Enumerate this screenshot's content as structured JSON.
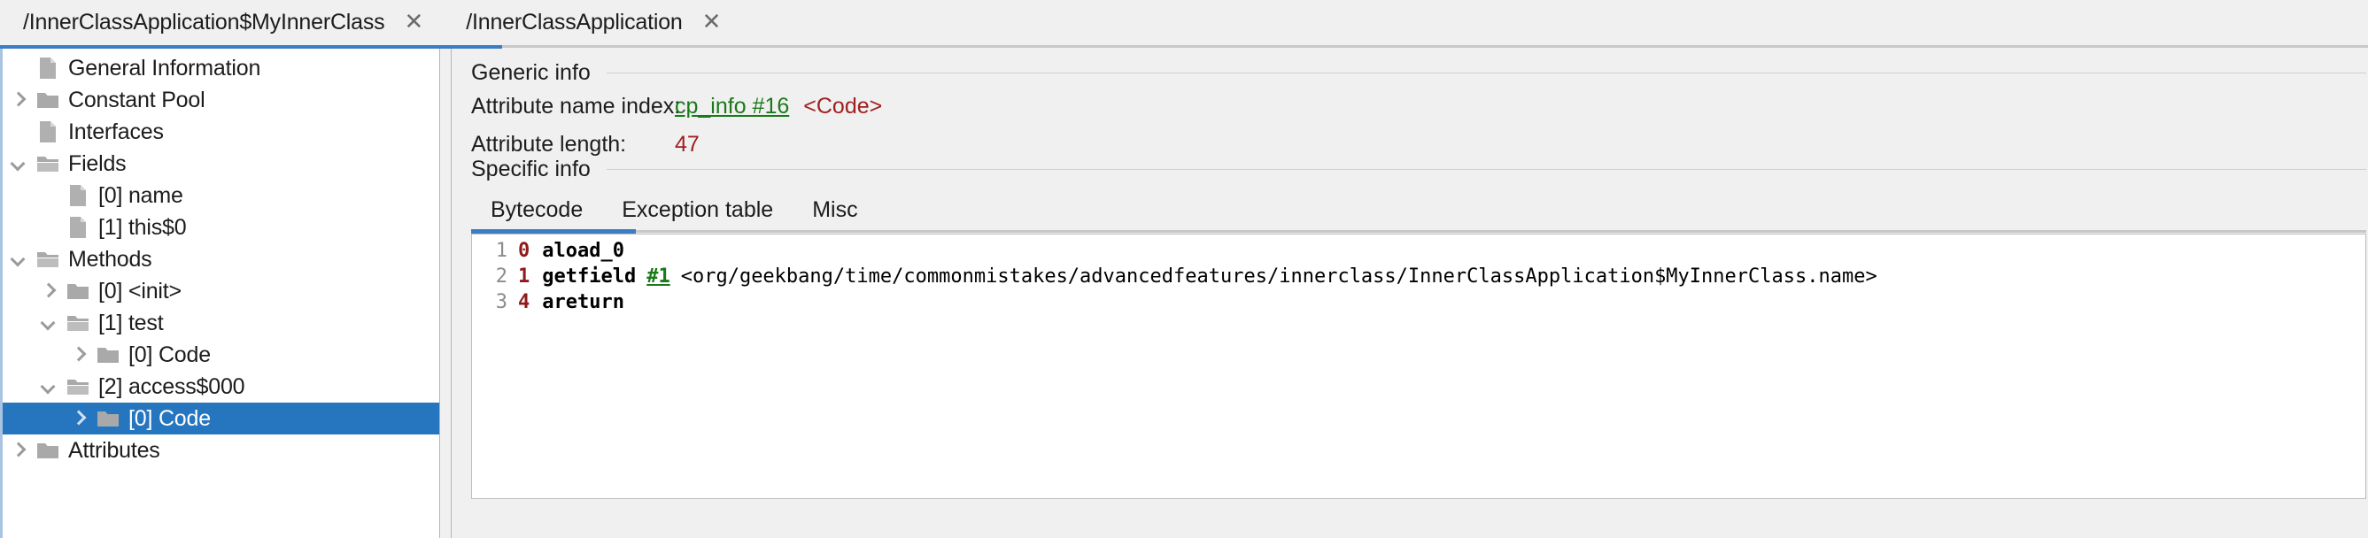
{
  "window": {
    "tabs": [
      {
        "label": "/InnerClassApplication$MyInnerClass",
        "close": "✕",
        "active": true
      },
      {
        "label": "/InnerClassApplication",
        "close": "✕",
        "active": false
      }
    ]
  },
  "tree": {
    "items": [
      {
        "label": "General Information",
        "depth": 1,
        "toggle": "none",
        "icon": "file",
        "selected": false
      },
      {
        "label": "Constant Pool",
        "depth": 1,
        "toggle": "right",
        "icon": "folder",
        "selected": false
      },
      {
        "label": "Interfaces",
        "depth": 1,
        "toggle": "none",
        "icon": "file",
        "selected": false
      },
      {
        "label": "Fields",
        "depth": 1,
        "toggle": "down",
        "icon": "folder-open",
        "selected": false
      },
      {
        "label": "[0] name",
        "depth": 2,
        "toggle": "none",
        "icon": "file",
        "selected": false
      },
      {
        "label": "[1] this$0",
        "depth": 2,
        "toggle": "none",
        "icon": "file",
        "selected": false
      },
      {
        "label": "Methods",
        "depth": 1,
        "toggle": "down",
        "icon": "folder-open",
        "selected": false
      },
      {
        "label": "[0] <init>",
        "depth": 2,
        "toggle": "right",
        "icon": "folder",
        "selected": false
      },
      {
        "label": "[1] test",
        "depth": 2,
        "toggle": "down",
        "icon": "folder-open",
        "selected": false
      },
      {
        "label": "[0] Code",
        "depth": 3,
        "toggle": "right",
        "icon": "folder",
        "selected": false
      },
      {
        "label": "[2] access$000",
        "depth": 2,
        "toggle": "down",
        "icon": "folder-open",
        "selected": false
      },
      {
        "label": "[0] Code",
        "depth": 3,
        "toggle": "right",
        "icon": "folder",
        "selected": true
      },
      {
        "label": "Attributes",
        "depth": 1,
        "toggle": "right",
        "icon": "folder",
        "selected": false
      }
    ]
  },
  "detail": {
    "generic_info_title": "Generic info",
    "specific_info_title": "Specific info",
    "attribute_name_index_label": "Attribute name index:",
    "attribute_name_index_link": "cp_info #16",
    "attribute_name_index_desc": "<Code>",
    "attribute_length_label": "Attribute length:",
    "attribute_length_value": "47",
    "subtabs": [
      {
        "label": "Bytecode",
        "active": true
      },
      {
        "label": "Exception table",
        "active": false
      },
      {
        "label": "Misc",
        "active": false
      }
    ],
    "bytecode": [
      {
        "line": "1",
        "offset": "0",
        "mnemonic": "aload_0",
        "ref": "",
        "arg": ""
      },
      {
        "line": "2",
        "offset": "1",
        "mnemonic": "getfield",
        "ref": "#1",
        "arg": "<org/geekbang/time/commonmistakes/advancedfeatures/innerclass/InnerClassApplication$MyInnerClass.name>"
      },
      {
        "line": "3",
        "offset": "4",
        "mnemonic": "areturn",
        "ref": "",
        "arg": ""
      }
    ]
  },
  "colors": {
    "accent_blue": "#3b7dc4",
    "selection_blue": "#2675bf",
    "link_green": "#1a7a1a",
    "value_red": "#a02020",
    "panel_bg": "#f0f0f0"
  }
}
